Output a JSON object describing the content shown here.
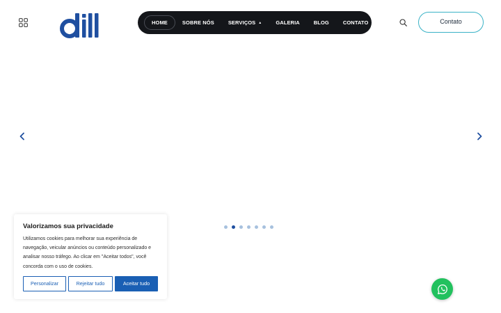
{
  "header": {
    "menu_icon": "grid-icon",
    "logo_text": "dil",
    "nav_items": [
      {
        "label": "HOME",
        "active": true
      },
      {
        "label": "SOBRE NÓS",
        "active": false
      },
      {
        "label": "SERVIÇOS",
        "active": false,
        "caret": "▲"
      },
      {
        "label": "GALERIA",
        "active": false
      },
      {
        "label": "BLOG",
        "active": false
      },
      {
        "label": "CONTATO",
        "active": false
      }
    ],
    "search_icon": "search-icon",
    "contact_button": "Contato"
  },
  "slider": {
    "prev_icon": "chevron-left-icon",
    "next_icon": "chevron-right-icon",
    "slide_count": 7,
    "active_slide": 2
  },
  "cookie_banner": {
    "title": "Valorizamos sua privacidade",
    "text": "Utilizamos cookies para melhorar sua experiência de navegação, veicular anúncios ou conteúdo personalizado e analisar nosso tráfego. Ao clicar em \"Aceitar todos\", você concorda com o uso de cookies.",
    "customize_label": "Personalizar",
    "reject_label": "Rejeitar tudo",
    "accept_label": "Aceitar tudo"
  },
  "whatsapp_icon": "whatsapp-icon",
  "colors": {
    "nav_background": "#14161a",
    "contact_border": "#39b2c6",
    "brand_blue": "#1a5fb4",
    "logo_blue": "#1f4fa0",
    "dot_inactive": "#a7c1de",
    "whatsapp_green": "#22c15e"
  }
}
